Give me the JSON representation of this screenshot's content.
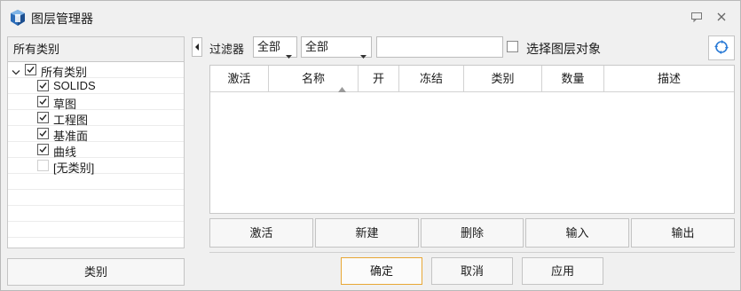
{
  "window": {
    "title": "图层管理器",
    "icons": [
      "app-logo-icon",
      "feedback-icon",
      "close-icon"
    ]
  },
  "left": {
    "header": "所有类别",
    "tree": [
      {
        "label": "所有类别",
        "checked": true,
        "root": true
      },
      {
        "label": "SOLIDS",
        "checked": true
      },
      {
        "label": "草图",
        "checked": true
      },
      {
        "label": "工程图",
        "checked": true
      },
      {
        "label": "基准面",
        "checked": true
      },
      {
        "label": "曲线",
        "checked": true
      },
      {
        "label": "[无类别]",
        "checked": false
      }
    ],
    "category_button": "类别"
  },
  "filter": {
    "label": "过滤器",
    "select1": "全部",
    "select2": "全部",
    "input_value": "",
    "select_objects_label": "选择图层对象",
    "select_objects_checked": false
  },
  "table": {
    "columns": [
      "激活",
      "名称",
      "开",
      "冻结",
      "类别",
      "数量",
      "描述"
    ],
    "sorted_column": "名称",
    "rows": []
  },
  "actions": [
    "激活",
    "新建",
    "删除",
    "输入",
    "输出"
  ],
  "dialog": {
    "ok": "确定",
    "cancel": "取消",
    "apply": "应用"
  },
  "colors": {
    "accent_border": "#e8a735",
    "check": "#1a1a1a"
  }
}
